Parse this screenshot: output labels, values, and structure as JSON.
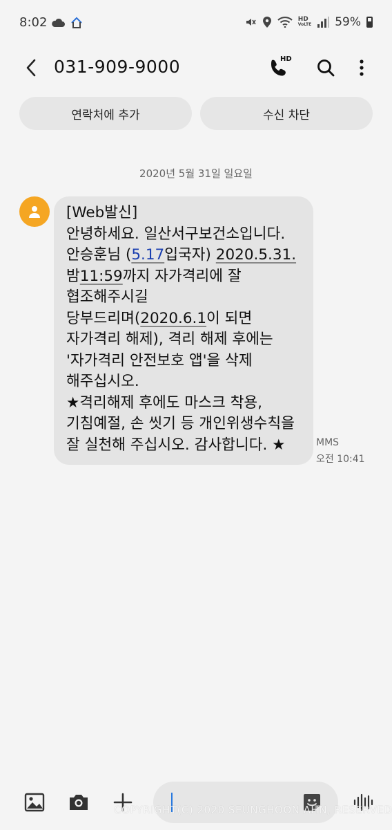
{
  "status_bar": {
    "time": "8:02",
    "battery": "59%",
    "icons": [
      "cloud-icon",
      "home-icon",
      "mute-icon",
      "location-icon",
      "wifi-icon",
      "hd-voice-icon",
      "signal-icon",
      "battery-icon"
    ],
    "hd_voice_label_top": "HD",
    "hd_voice_label_bottom": "VoLTE"
  },
  "header": {
    "title": "031-909-9000",
    "call_hd_label": "HD"
  },
  "actions": {
    "add_contact": "연락처에 추가",
    "block": "수신 차단"
  },
  "date_divider": "2020년 5월 31일 일요일",
  "message": {
    "lines": [
      [
        {
          "t": "[Web발신]"
        }
      ],
      [
        {
          "t": "안녕하세요. 일산서구보건소입니다."
        }
      ],
      [
        {
          "t": "안승훈님 ("
        },
        {
          "t": "5.17",
          "style": "link"
        },
        {
          "t": "입국자) "
        },
        {
          "t": "2020.5.31.",
          "style": "ul"
        }
      ],
      [
        {
          "t": "밤"
        },
        {
          "t": "11:59",
          "style": "ul"
        },
        {
          "t": "까지 자가격리에 잘"
        }
      ],
      [
        {
          "t": "협조해주시길"
        }
      ],
      [
        {
          "t": "당부드리며("
        },
        {
          "t": "2020.6.1",
          "style": "ul"
        },
        {
          "t": "이 되면"
        }
      ],
      [
        {
          "t": "자가격리 해제), 격리 해제 후에는"
        }
      ],
      [
        {
          "t": "'자가격리 안전보호 앱'을 삭제"
        }
      ],
      [
        {
          "t": "해주십시오."
        }
      ],
      [
        {
          "t": "★격리해제 후에도 마스크 착용,"
        }
      ],
      [
        {
          "t": "기침예절, 손 씻기 등 개인위생수칙을"
        }
      ],
      [
        {
          "t": "잘 실천해 주십시오. 감사합니다. ★"
        }
      ]
    ],
    "type": "MMS",
    "time": "오전 10:41"
  },
  "composer": {
    "placeholder": "",
    "watermark": "COPYRIGHT(C) 2020 SEUNGHOON AHN, RESERVED"
  },
  "colors": {
    "background": "#f4f4f4",
    "bubble": "#e4e4e4",
    "avatar": "#f5a623",
    "link": "#1a3fb0",
    "cursor": "#2a7adf"
  }
}
